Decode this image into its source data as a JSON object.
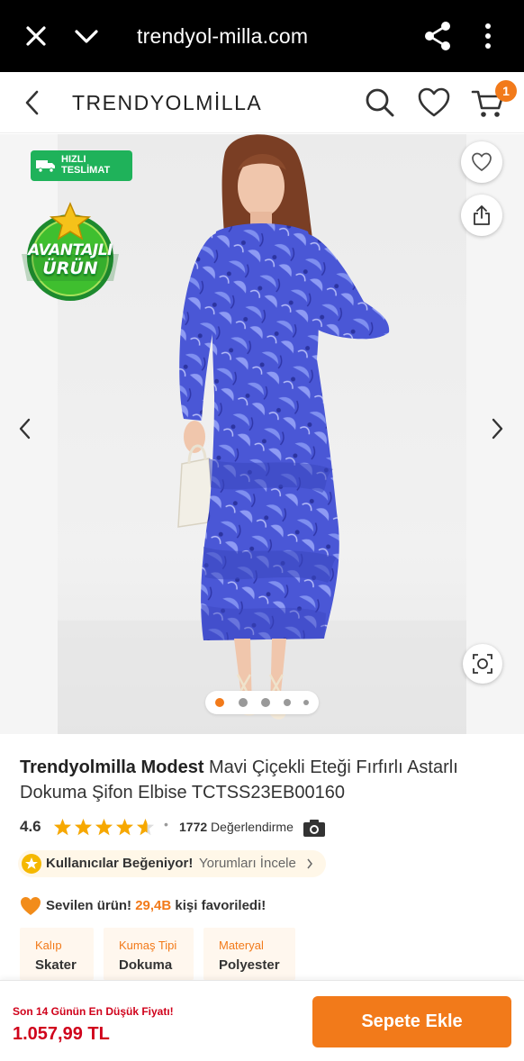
{
  "browser": {
    "url": "trendyol-milla.com",
    "icons": [
      "close-icon",
      "chevron-down-icon",
      "share-icon",
      "more-vert-icon"
    ]
  },
  "header": {
    "brand": "TRENDYOLMİLLA",
    "cart_count": "1",
    "icons": [
      "back-arrow-icon",
      "search-icon",
      "heart-icon",
      "cart-icon"
    ]
  },
  "gallery": {
    "fast_delivery_badge": "HIZLI\nTESLİMAT",
    "advantage_badge_line1": "AVANTAJLI",
    "advantage_badge_line2": "ÜRÜN",
    "image_count": 5,
    "active_image_index": 0
  },
  "product": {
    "brand": "Trendyolmilla Modest",
    "name": " Mavi Çiçekli Eteği Fırfırlı Astarlı Dokuma Şifon Elbise TCTSS23EB00160",
    "rating": "4.6",
    "rating_value": 4.6,
    "rating_count": "1772",
    "rating_label": " Değerlendirme",
    "separator": "•",
    "liked_text": "Kullanıcılar Beğeniyor!",
    "reviews_link": "Yorumları İncele",
    "fav_prefix": "Sevilen ürün! ",
    "fav_count": "29,4B",
    "fav_suffix": " kişi favoriledi!",
    "attributes": [
      {
        "key": "Kalıp",
        "value": "Skater"
      },
      {
        "key": "Kumaş Tipi",
        "value": "Dokuma"
      },
      {
        "key": "Materyal",
        "value": "Polyester"
      }
    ]
  },
  "bottom": {
    "lowest_price_label": "Son 14 Günün En Düşük Fiyatı!",
    "price": "1.057,99 TL",
    "add_to_cart": "Sepete Ekle"
  },
  "colors": {
    "accent": "#f27a1a",
    "price_red": "#d0021b",
    "fast_green": "#1fb25a",
    "dress_blue": "#4a5ad8"
  }
}
